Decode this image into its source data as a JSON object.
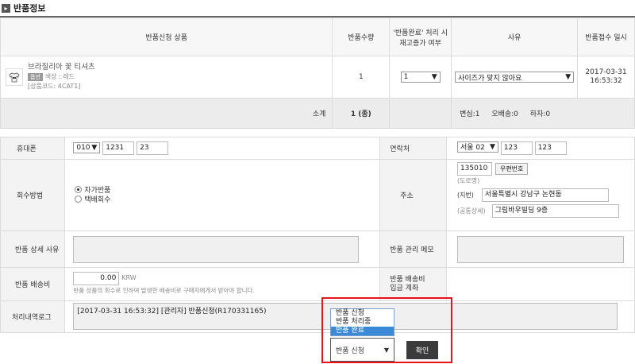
{
  "section_title": "반품정보",
  "header": {
    "product": "반품신청 상품",
    "qty": "반품수량",
    "stock_line1": "'반품완료' 처리 시",
    "stock_line2": "재고증가 여부",
    "reason": "사유",
    "date": "반품접수 일시"
  },
  "item": {
    "name": "브라질리아 꽃 티셔츠",
    "badge": "옵션",
    "option": "색상 : 레드",
    "code": "[상품코드: 4CAT1]",
    "qty": "1",
    "stock_select": "1",
    "reason_select": "사이즈가 맞지 않아요",
    "date_line1": "2017-03-31",
    "date_line2": "16:53:32"
  },
  "summary": {
    "label": "소계",
    "count": "1 (종)",
    "change": "변심:1",
    "misdelivery": "오배송:0",
    "defect": "하자:0"
  },
  "form": {
    "mobile_label": "휴대폰",
    "mobile_prefix": "010",
    "mobile_mid": "1231",
    "mobile_last": "23",
    "contact_label": "연락처",
    "contact_prefix": "서울 02",
    "contact_mid": "123",
    "contact_last": "123",
    "method_label": "회수방법",
    "method_opt1": "자가반품",
    "method_opt2": "택배회수",
    "address_label": "주소",
    "zip": "135010",
    "zip_button": "우편번호",
    "road_tag": "(도로명)",
    "jibun_tag": "(지번)",
    "jibun_value": "서울특별시 강남구 논현동",
    "detail_tag": "(공통상세)",
    "detail_value": "그림바우빌딩 9층",
    "detail_reason_label": "반품 상세 사유",
    "memo_label": "반품 관리 메모",
    "fee_label": "반품 배송비",
    "fee_value": "0.00",
    "fee_unit": "KRW",
    "fee_note": "반품 상품의 회수로 인하여 발생한 배송비로 구매자에게서 받아야 합니다.",
    "account_label1": "반품 배송비",
    "account_label2": "입금 계좌",
    "log_label": "처리내역로그",
    "log_text": "[2017-03-31 16:53:32] [관리자]  반품신청(R170331165)"
  },
  "status_dropdown": {
    "options": [
      "반품 신청",
      "반품 처리중",
      "반품 완료"
    ],
    "highlighted": "반품 완료",
    "selected": "반품 신청"
  },
  "confirm_button": "확인",
  "colors": {
    "highlight_box": "#e8141b",
    "option_highlight": "#3a8ad8",
    "confirm_bg": "#3b3b3b"
  }
}
